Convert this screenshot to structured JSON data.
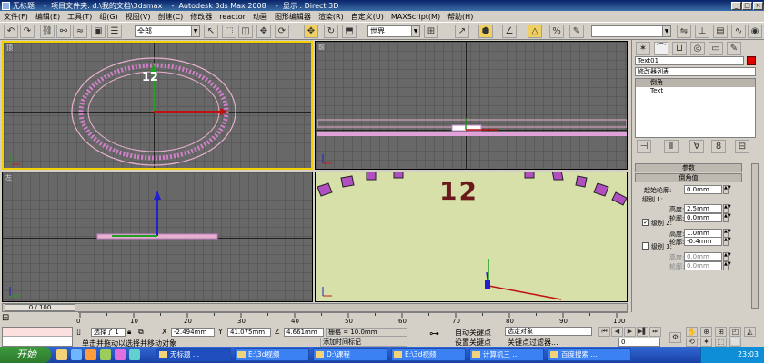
{
  "window": {
    "title": "无标题    -  项目文件夹: d:\\我的文档\\3dsmax    -  Autodesk 3ds Max 2008    -  显示 : Direct 3D",
    "minimize_label": "_",
    "maximize_label": "□",
    "close_label": "×"
  },
  "menu": [
    "文件(F)",
    "编辑(E)",
    "工具(T)",
    "组(G)",
    "视图(V)",
    "创建(C)",
    "修改器",
    "reactor",
    "动画",
    "图形编辑器",
    "渲染(R)",
    "自定义(U)",
    "MAXScript(M)",
    "帮助(H)"
  ],
  "toolbar": {
    "selection_filter": "全部",
    "coord_system": "世界"
  },
  "viewports": {
    "top_label": "顶",
    "front_label": "前",
    "left_label": "左",
    "persp_text": "12",
    "top_text": "12"
  },
  "command_panel": {
    "object_name": "Text01",
    "modifier_list": "修改器列表",
    "stack_items": [
      "倒角",
      "Text"
    ],
    "rollout_params": "参数",
    "rollout_bevel": "倒角值",
    "start_outline_label": "起始轮廓:",
    "start_outline_value": "0.0mm",
    "level1_label": "级别 1:",
    "height_label": "高度:",
    "outline_label": "轮廓:",
    "level1_height": "2.5mm",
    "level1_outline": "0.0mm",
    "level2_label": "级别 2:",
    "level2_height": "1.0mm",
    "level2_outline": "-0.4mm",
    "level3_label": "级别 3:",
    "level3_height": "0.0mm",
    "level3_outline": "0.0mm",
    "level2_checked": true,
    "level3_checked": false
  },
  "timeline": {
    "slider_label": "0 / 100",
    "ticks": [
      "0",
      "10",
      "20",
      "30",
      "40",
      "50",
      "60",
      "70",
      "80",
      "90",
      "100"
    ]
  },
  "status": {
    "selected": "选择了 1",
    "x_label": "X",
    "x_value": "-2.494mm",
    "y_label": "Y",
    "y_value": "41.075mm",
    "z_label": "Z",
    "z_value": "4.661mm",
    "grid": "栅格 = 10.0mm",
    "prompt": "单击并拖动以选择并移动对象",
    "add_time_tag": "添加时间标记",
    "auto_key": "自动关键点",
    "set_key": "设置关键点",
    "key_filter_select": "选定对象",
    "key_filters": "关键点过滤器...",
    "frame_value": "0"
  },
  "taskbar": {
    "start": "开始",
    "tasks": [
      "无标题 ...",
      "E:\\3d视频",
      "D:\\课程",
      "E:\\3d视频",
      "计算机三 ...",
      "百度搜索 ..."
    ],
    "clock": "23:03"
  },
  "colors": {
    "titlebar": "#0a246a",
    "viewport_bg": "#686868",
    "persp_bg": "#d7e0a8",
    "active_border": "#f0d000",
    "text_red": "#6a1a1a",
    "taskbar": "#245edb"
  }
}
